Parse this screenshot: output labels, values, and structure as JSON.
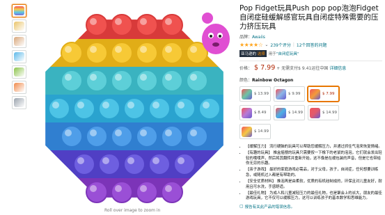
{
  "product": {
    "title": "Pop Fidget玩具Push pop pop泡泡Fidget自闭症硅缓解感官玩具自闭症特殊需要的压力挤压玩具",
    "brand_label": "品牌：",
    "brand": "Awaiis",
    "stars": "★★★★☆",
    "rating_count": "239个评分",
    "answered": "12个回答的问题",
    "badge_prefix": "亚马逊的",
    "badge_choice": "选择",
    "badge_for": "用于",
    "badge_link": "\"自闭症玩具\"",
    "price_label": "价格：",
    "price": "$ 7.99",
    "price_note": "+ 无需支付$ 9.41运往中国",
    "price_link": "详细信息",
    "color_label": "颜色：",
    "color_value": "Rainbow Octagon",
    "roll_hint": "Roll over image to zoom in"
  },
  "swatches": [
    {
      "price": "$ 13.99",
      "icon": "green-blue-popper",
      "selected": false,
      "color": "#6cc4a4"
    },
    {
      "price": "$ 9.99",
      "icon": "rainbow-triangle",
      "selected": false,
      "color": "#8bb6e8"
    },
    {
      "price": "$ 7.99",
      "icon": "rainbow-octagon",
      "selected": true,
      "color": "#f39b3a"
    },
    {
      "price": "",
      "icon": "empty",
      "selected": false,
      "color": "#ffffff"
    },
    {
      "price": "$ 8.49",
      "icon": "rainbow-square",
      "selected": false,
      "color": "#b77ad6"
    },
    {
      "price": "$ 14.99",
      "icon": "duo-popper",
      "selected": false,
      "color": "#4bb0e6"
    },
    {
      "price": "$ 14.99",
      "icon": "circle-popper",
      "selected": false,
      "color": "#e05a6e"
    },
    {
      "price": "",
      "icon": "empty",
      "selected": false,
      "color": "#ffffff"
    },
    {
      "price": "$ 14.99",
      "icon": "rainbow-circle",
      "selected": false,
      "color": "#f5c842"
    }
  ],
  "bullets": [
    "【缓解压力】 流行硬脑的玩具可以帮助您缓解压力，并通过抓住气泡来恢复情绪。",
    "【有趣的玩具】 推盒摇摆的玩具只需要按一下橡下的老鼠的泡泡，它们就会发出轻轻的噗噗声，然后将其翻转并重新开始，这不像是在缓包装的声音，但是它也带给你无穷的乐趣。",
    "【亲子游戏】 最好的家庭游戏必需品，对于父母，孩子，自闭症，任何想要训练急，或随机过入都是有帮助的。",
    "【安全优质材料】 推泡再是由柔软，优质的有机硅制成的，环保且对儿童友好，耐用且可水洗，手感舒适。",
    "【最佳礼物】 为成人和儿童减轻压力的最佳礼物，也是聚会上的派大，朋友的最佳游戏玩具，它不仅可以缓解压力，这可以训练孩子的基本数学和思维能力。"
  ],
  "report_link": "报告有关此产品的错误信息。",
  "thumbnails": [
    {
      "name": "rainbow-octagon",
      "color": "#f39b3a"
    },
    {
      "name": "octagon-photo",
      "color": "#e9c46a"
    },
    {
      "name": "hand-demo",
      "color": "#d8a77b"
    },
    {
      "name": "rainbow-alt",
      "color": "#5bb8e8"
    },
    {
      "name": "kid-playing",
      "color": "#8bc34a"
    },
    {
      "name": "box-package",
      "color": "#f08a4b"
    },
    {
      "name": "video-thumb",
      "color": "#9aa3ad"
    }
  ]
}
